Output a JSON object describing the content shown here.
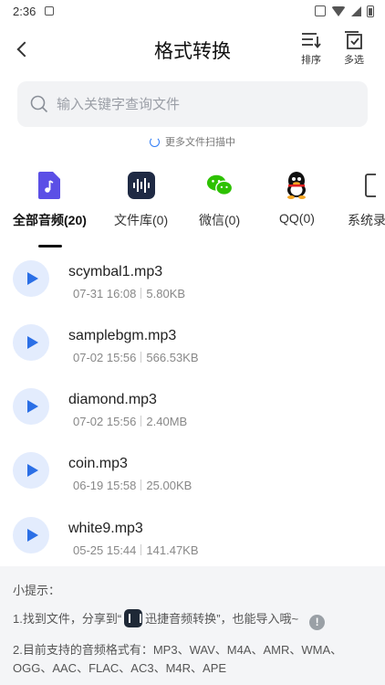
{
  "status_bar": {
    "time": "2:36"
  },
  "header": {
    "title": "格式转换",
    "sort_label": "排序",
    "multi_label": "多选"
  },
  "search": {
    "placeholder": "输入关键字查询文件"
  },
  "scan_status": "更多文件扫描中",
  "tabs": [
    {
      "label": "全部音频(20)",
      "icon": "music-file-icon",
      "color": "#5b4fe6",
      "active": true
    },
    {
      "label": "文件库(0)",
      "icon": "audio-library-icon",
      "color": "#1f2a44",
      "active": false
    },
    {
      "label": "微信(0)",
      "icon": "wechat-icon",
      "color": "#2dc100",
      "active": false
    },
    {
      "label": "QQ(0)",
      "icon": "qq-icon",
      "color": "#111111",
      "active": false
    },
    {
      "label": "系统录",
      "icon": "phone-icon",
      "color": "#333333",
      "active": false
    }
  ],
  "files": [
    {
      "name": "scymbal1.mp3",
      "date": "07-31 16:08",
      "size": "5.80KB"
    },
    {
      "name": "samplebgm.mp3",
      "date": "07-02 15:56",
      "size": "566.53KB"
    },
    {
      "name": "diamond.mp3",
      "date": "07-02 15:56",
      "size": "2.40MB"
    },
    {
      "name": "coin.mp3",
      "date": "06-19 15:58",
      "size": "25.00KB"
    },
    {
      "name": "white9.mp3",
      "date": "05-25 15:44",
      "size": "141.47KB"
    }
  ],
  "tips": {
    "title": "小提示：",
    "line1_prefix": "1.找到文件，分享到“",
    "line1_app": "迅捷音频转换",
    "line1_suffix": "”，也能导入哦~",
    "line2": "2.目前支持的音频格式有：MP3、WAV、M4A、AMR、WMA、OGG、AAC、FLAC、AC3、M4R、APE"
  },
  "colors": {
    "accent": "#2b6fe6",
    "tip_bg": "#f4f5f7"
  }
}
